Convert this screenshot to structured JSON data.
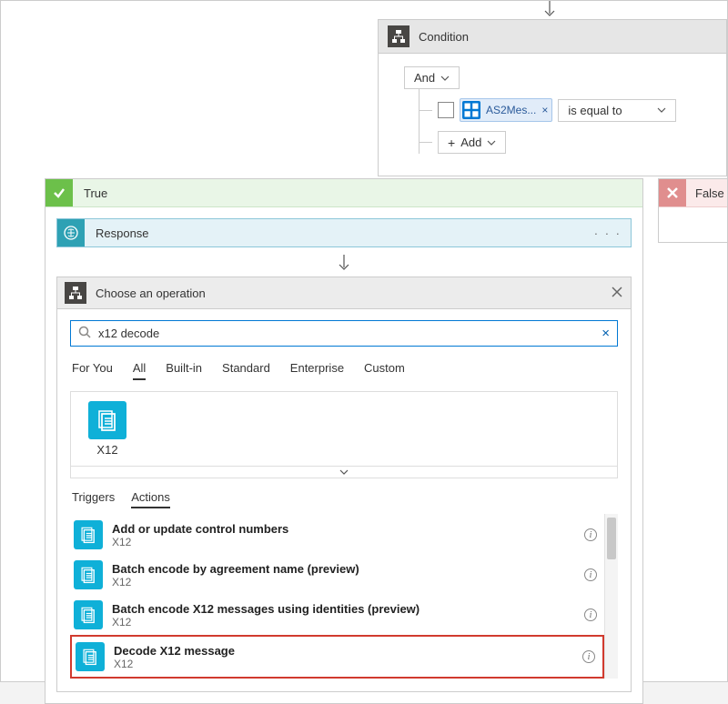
{
  "condition": {
    "title": "Condition",
    "and_label": "And",
    "token_label": "AS2Mes...",
    "operator_label": "is equal to",
    "add_label": "Add"
  },
  "true_branch": {
    "label": "True"
  },
  "false_branch": {
    "label": "False"
  },
  "response": {
    "label": "Response"
  },
  "choose_op": {
    "title": "Choose an operation",
    "search_value": "x12 decode",
    "tabs": {
      "for_you": "For You",
      "all": "All",
      "built_in": "Built-in",
      "standard": "Standard",
      "enterprise": "Enterprise",
      "custom": "Custom"
    },
    "connector_name": "X12",
    "ta": {
      "triggers": "Triggers",
      "actions": "Actions"
    },
    "actions": [
      {
        "title": "Add or update control numbers",
        "sub": "X12"
      },
      {
        "title": "Batch encode by agreement name (preview)",
        "sub": "X12"
      },
      {
        "title": "Batch encode X12 messages using identities (preview)",
        "sub": "X12"
      },
      {
        "title": "Decode X12 message",
        "sub": "X12"
      }
    ]
  }
}
